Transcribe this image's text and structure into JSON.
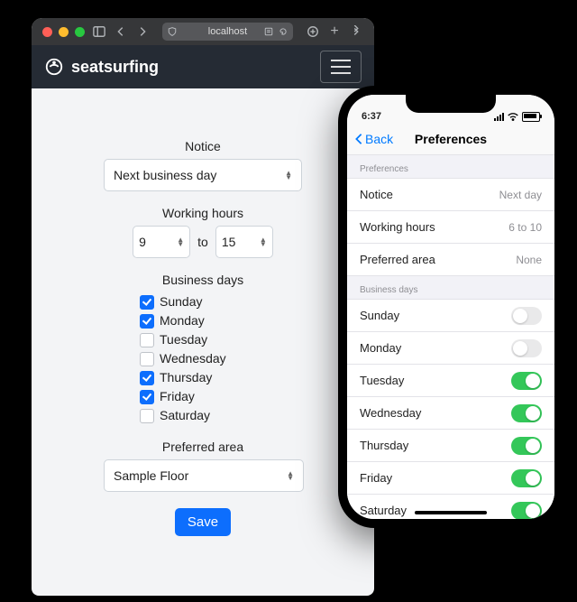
{
  "browser": {
    "url": "localhost",
    "brand": "seatsurfing"
  },
  "form": {
    "notice_label": "Notice",
    "notice_value": "Next business day",
    "hours_label": "Working hours",
    "hours_from": "9",
    "hours_to_word": "to",
    "hours_to": "15",
    "days_label": "Business days",
    "days": [
      {
        "label": "Sunday",
        "checked": true
      },
      {
        "label": "Monday",
        "checked": true
      },
      {
        "label": "Tuesday",
        "checked": false
      },
      {
        "label": "Wednesday",
        "checked": false
      },
      {
        "label": "Thursday",
        "checked": true
      },
      {
        "label": "Friday",
        "checked": true
      },
      {
        "label": "Saturday",
        "checked": false
      }
    ],
    "area_label": "Preferred area",
    "area_value": "Sample Floor",
    "save_label": "Save"
  },
  "phone": {
    "time": "6:37",
    "back": "Back",
    "title": "Preferences",
    "section1": "Preferences",
    "rows1": [
      {
        "label": "Notice",
        "value": "Next day"
      },
      {
        "label": "Working hours",
        "value": "6 to 10"
      },
      {
        "label": "Preferred area",
        "value": "None"
      }
    ],
    "section2": "Business days",
    "rows2": [
      {
        "label": "Sunday",
        "on": false
      },
      {
        "label": "Monday",
        "on": false
      },
      {
        "label": "Tuesday",
        "on": true
      },
      {
        "label": "Wednesday",
        "on": true
      },
      {
        "label": "Thursday",
        "on": true
      },
      {
        "label": "Friday",
        "on": true
      },
      {
        "label": "Saturday",
        "on": true
      }
    ]
  }
}
